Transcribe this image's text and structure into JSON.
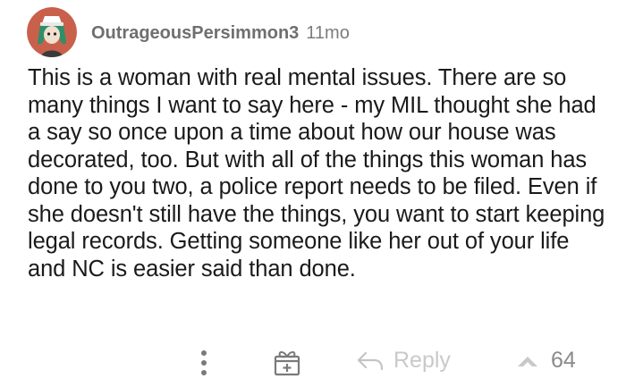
{
  "comment": {
    "username": "OutrageousPersimmon3",
    "timestamp": "11mo",
    "body": "This is a woman with real mental issues. There are so many things I want to say here - my MIL thought she had a say so once upon a time about how our house was decorated, too. But with all of the things this woman has done to you two, a police report needs to be filed. Even if she doesn't still have the things, you want to start keeping legal records. Getting someone like her out of your life and NC is easier said than done."
  },
  "actions": {
    "reply_label": "Reply",
    "upvote_count": "64"
  },
  "icons": {
    "more": "more-vertical-icon",
    "award": "gift-award-icon",
    "reply": "reply-arrow-icon",
    "upvote": "upvote-arrow-icon"
  },
  "colors": {
    "avatar_bg": "#c9604b",
    "avatar_hair": "#2f8f69",
    "text": "#1a1a1a",
    "muted": "#6f6f6f",
    "action_icon": "#c6c6c6"
  }
}
